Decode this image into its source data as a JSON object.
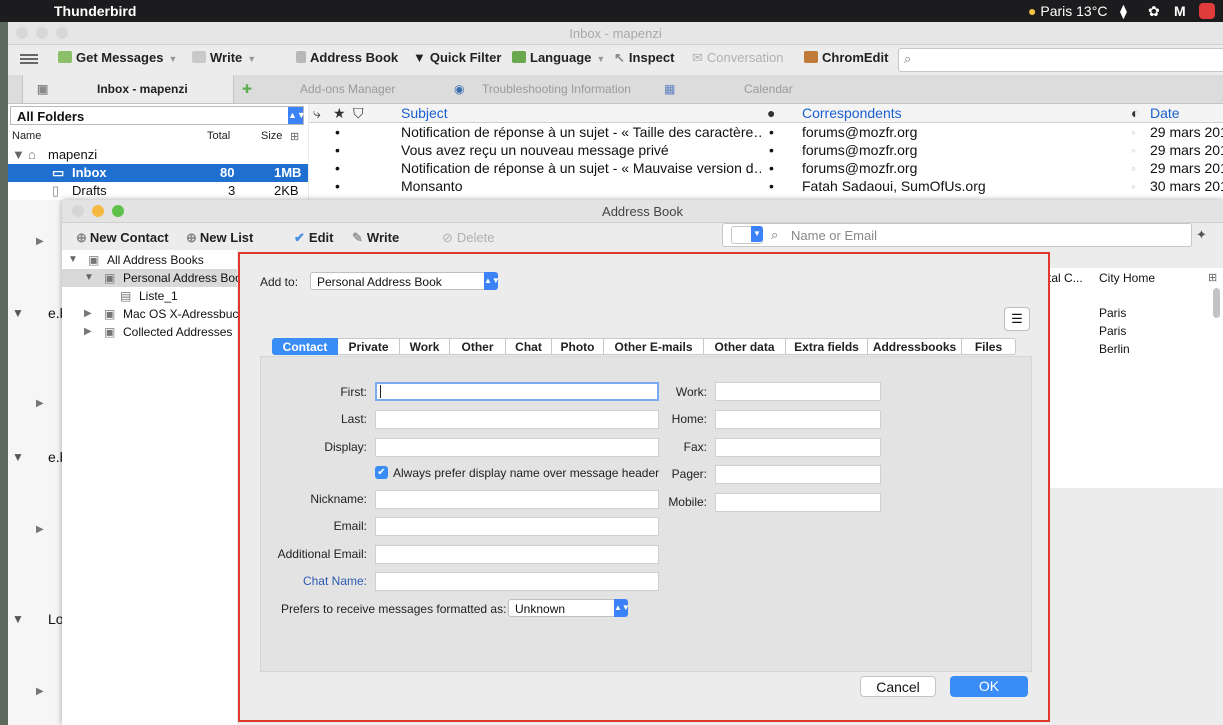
{
  "menubar": {
    "app_name": "Thunderbird",
    "weather": "Paris 13°C"
  },
  "main_window": {
    "title": "Inbox - mapenzi",
    "toolbar": {
      "get_messages": "Get Messages",
      "write": "Write",
      "address_book": "Address Book",
      "quick_filter": "Quick Filter",
      "language": "Language",
      "inspect": "Inspect",
      "conversation": "Conversation",
      "chromedit": "ChromEdit"
    },
    "tabs": [
      "Inbox - mapenzi",
      "Add-ons Manager",
      "Troubleshooting Information",
      "Calendar"
    ],
    "folder_pane": {
      "selector": "All Folders",
      "headers": {
        "name": "Name",
        "total": "Total",
        "size": "Size"
      },
      "folders": [
        {
          "name": "mapenzi",
          "total": "",
          "size": ""
        },
        {
          "name": "Inbox",
          "total": "80",
          "size": "1MB"
        },
        {
          "name": "Drafts",
          "total": "3",
          "size": "2KB"
        }
      ],
      "partial_labels": [
        "e.b",
        "e.b",
        "Lo"
      ]
    },
    "message_list": {
      "headers": {
        "subject": "Subject",
        "correspondents": "Correspondents",
        "date": "Date"
      },
      "rows": [
        {
          "subject": "Notification de réponse à un sujet - « Taille des caractère…",
          "from": "forums@mozfr.org",
          "date": "29 mars 201"
        },
        {
          "subject": "Vous avez reçu un nouveau message privé",
          "from": "forums@mozfr.org",
          "date": "29 mars 201"
        },
        {
          "subject": "Notification de réponse à un sujet - « Mauvaise version d…",
          "from": "forums@mozfr.org",
          "date": "29 mars 201"
        },
        {
          "subject": "Monsanto",
          "from": "Fatah Sadaoui, SumOfUs.org",
          "date": "30 mars 201"
        }
      ]
    }
  },
  "address_book": {
    "title": "Address Book",
    "toolbar": {
      "new_contact": "New Contact",
      "new_list": "New List",
      "edit": "Edit",
      "write": "Write",
      "delete": "Delete"
    },
    "search_placeholder": "Name or Email",
    "tree": [
      {
        "label": "All Address Books"
      },
      {
        "label": "Personal Address Book"
      },
      {
        "label": "Liste_1"
      },
      {
        "label": "Mac OS X-Adressbuch"
      },
      {
        "label": "Collected Addresses"
      }
    ],
    "columns": {
      "postal": "stal C...",
      "city_home": "City Home"
    },
    "cities": [
      "Paris",
      "Paris",
      "Berlin"
    ]
  },
  "dialog": {
    "add_to_label": "Add to:",
    "add_to_value": "Personal Address Book",
    "tabs": [
      "Contact",
      "Private",
      "Work",
      "Other",
      "Chat",
      "Photo",
      "Other E-mails",
      "Other data",
      "Extra fields",
      "Addressbooks",
      "Files"
    ],
    "fields_left": {
      "first": "First:",
      "last": "Last:",
      "display": "Display:",
      "prefer_display": "Always prefer display name over message header",
      "nickname": "Nickname:",
      "email": "Email:",
      "additional_email": "Additional Email:",
      "chat_name": "Chat Name:"
    },
    "fields_right": {
      "work": "Work:",
      "home": "Home:",
      "fax": "Fax:",
      "pager": "Pager:",
      "mobile": "Mobile:"
    },
    "format_label": "Prefers to receive messages formatted as:",
    "format_value": "Unknown",
    "cancel": "Cancel",
    "ok": "OK",
    "colors": {
      "accent": "#3a8df7",
      "highlight_border": "#e0392b"
    }
  }
}
